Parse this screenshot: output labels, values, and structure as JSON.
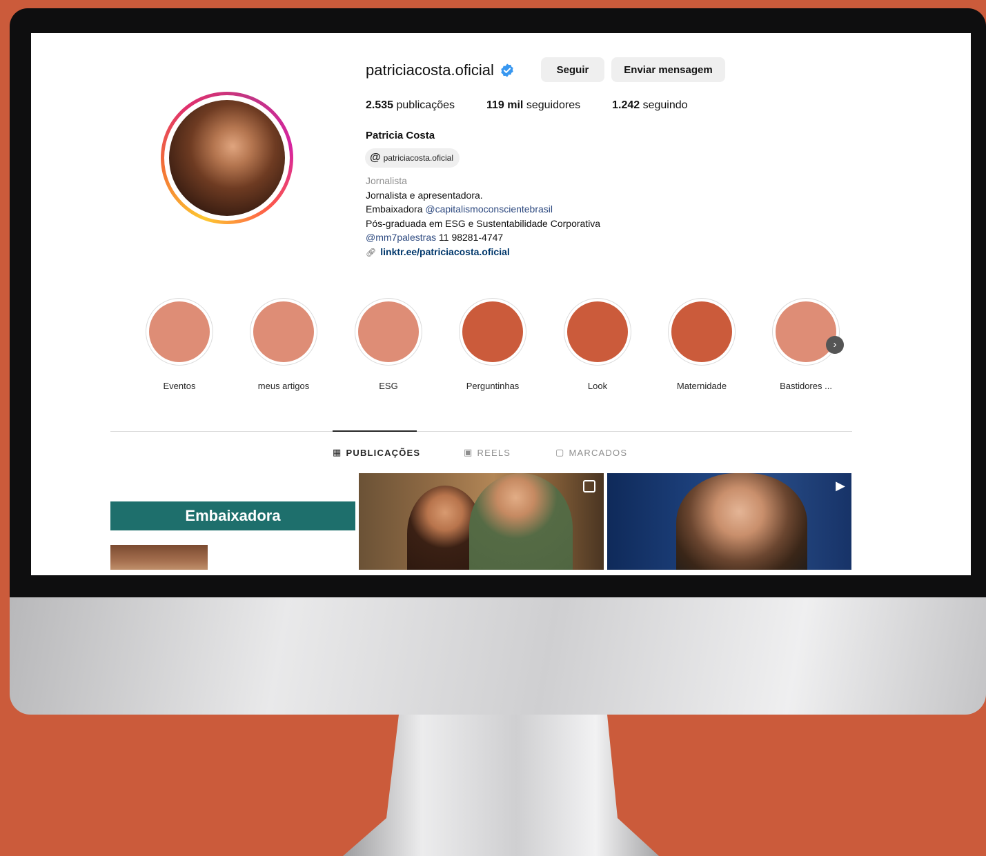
{
  "profile": {
    "username": "patriciacosta.oficial",
    "follow_label": "Seguir",
    "message_label": "Enviar mensagem",
    "stats": {
      "posts_count": "2.535",
      "posts_label": " publicações",
      "followers_count": "119 mil",
      "followers_label": " seguidores",
      "following_count": "1.242",
      "following_label": " seguindo"
    },
    "full_name": "Patricia Costa",
    "threads_handle": "patriciacosta.oficial",
    "category": "Jornalista",
    "bio": {
      "line1": "Jornalista e apresentadora.",
      "line2_prefix": "Embaixadora ",
      "line2_mention": "@capitalismoconscientebrasil",
      "line3": "Pós-graduada em ESG e Sustentabilidade Corporativa",
      "line4_mention": "@mm7palestras",
      "line4_text": " 11 98281-4747",
      "link": "linktr.ee/patriciacosta.oficial"
    }
  },
  "highlights": [
    {
      "label": "Eventos",
      "color": "#de8d76"
    },
    {
      "label": "meus artigos",
      "color": "#de8d76"
    },
    {
      "label": "ESG",
      "color": "#de8d76"
    },
    {
      "label": "Perguntinhas",
      "color": "#cb5b3b"
    },
    {
      "label": "Look",
      "color": "#cb5b3b"
    },
    {
      "label": "Maternidade",
      "color": "#cb5b3b"
    },
    {
      "label": "Bastidores ...",
      "color": "#de8d76"
    }
  ],
  "tabs": {
    "posts": "PUBLICAÇÕES",
    "reels": "REELS",
    "tagged": "MARCADOS"
  },
  "posts": {
    "first_banner": "Embaixadora"
  },
  "colors": {
    "background": "#cb5b3b",
    "verified": "#3897f0",
    "banner": "#1e6f6c"
  },
  "icons": {
    "verified": "verified-badge-icon",
    "threads": "threads-icon",
    "link": "link-icon",
    "grid": "grid-icon",
    "reels": "reels-icon",
    "tagged": "tagged-icon",
    "next": "chevron-right-icon"
  }
}
